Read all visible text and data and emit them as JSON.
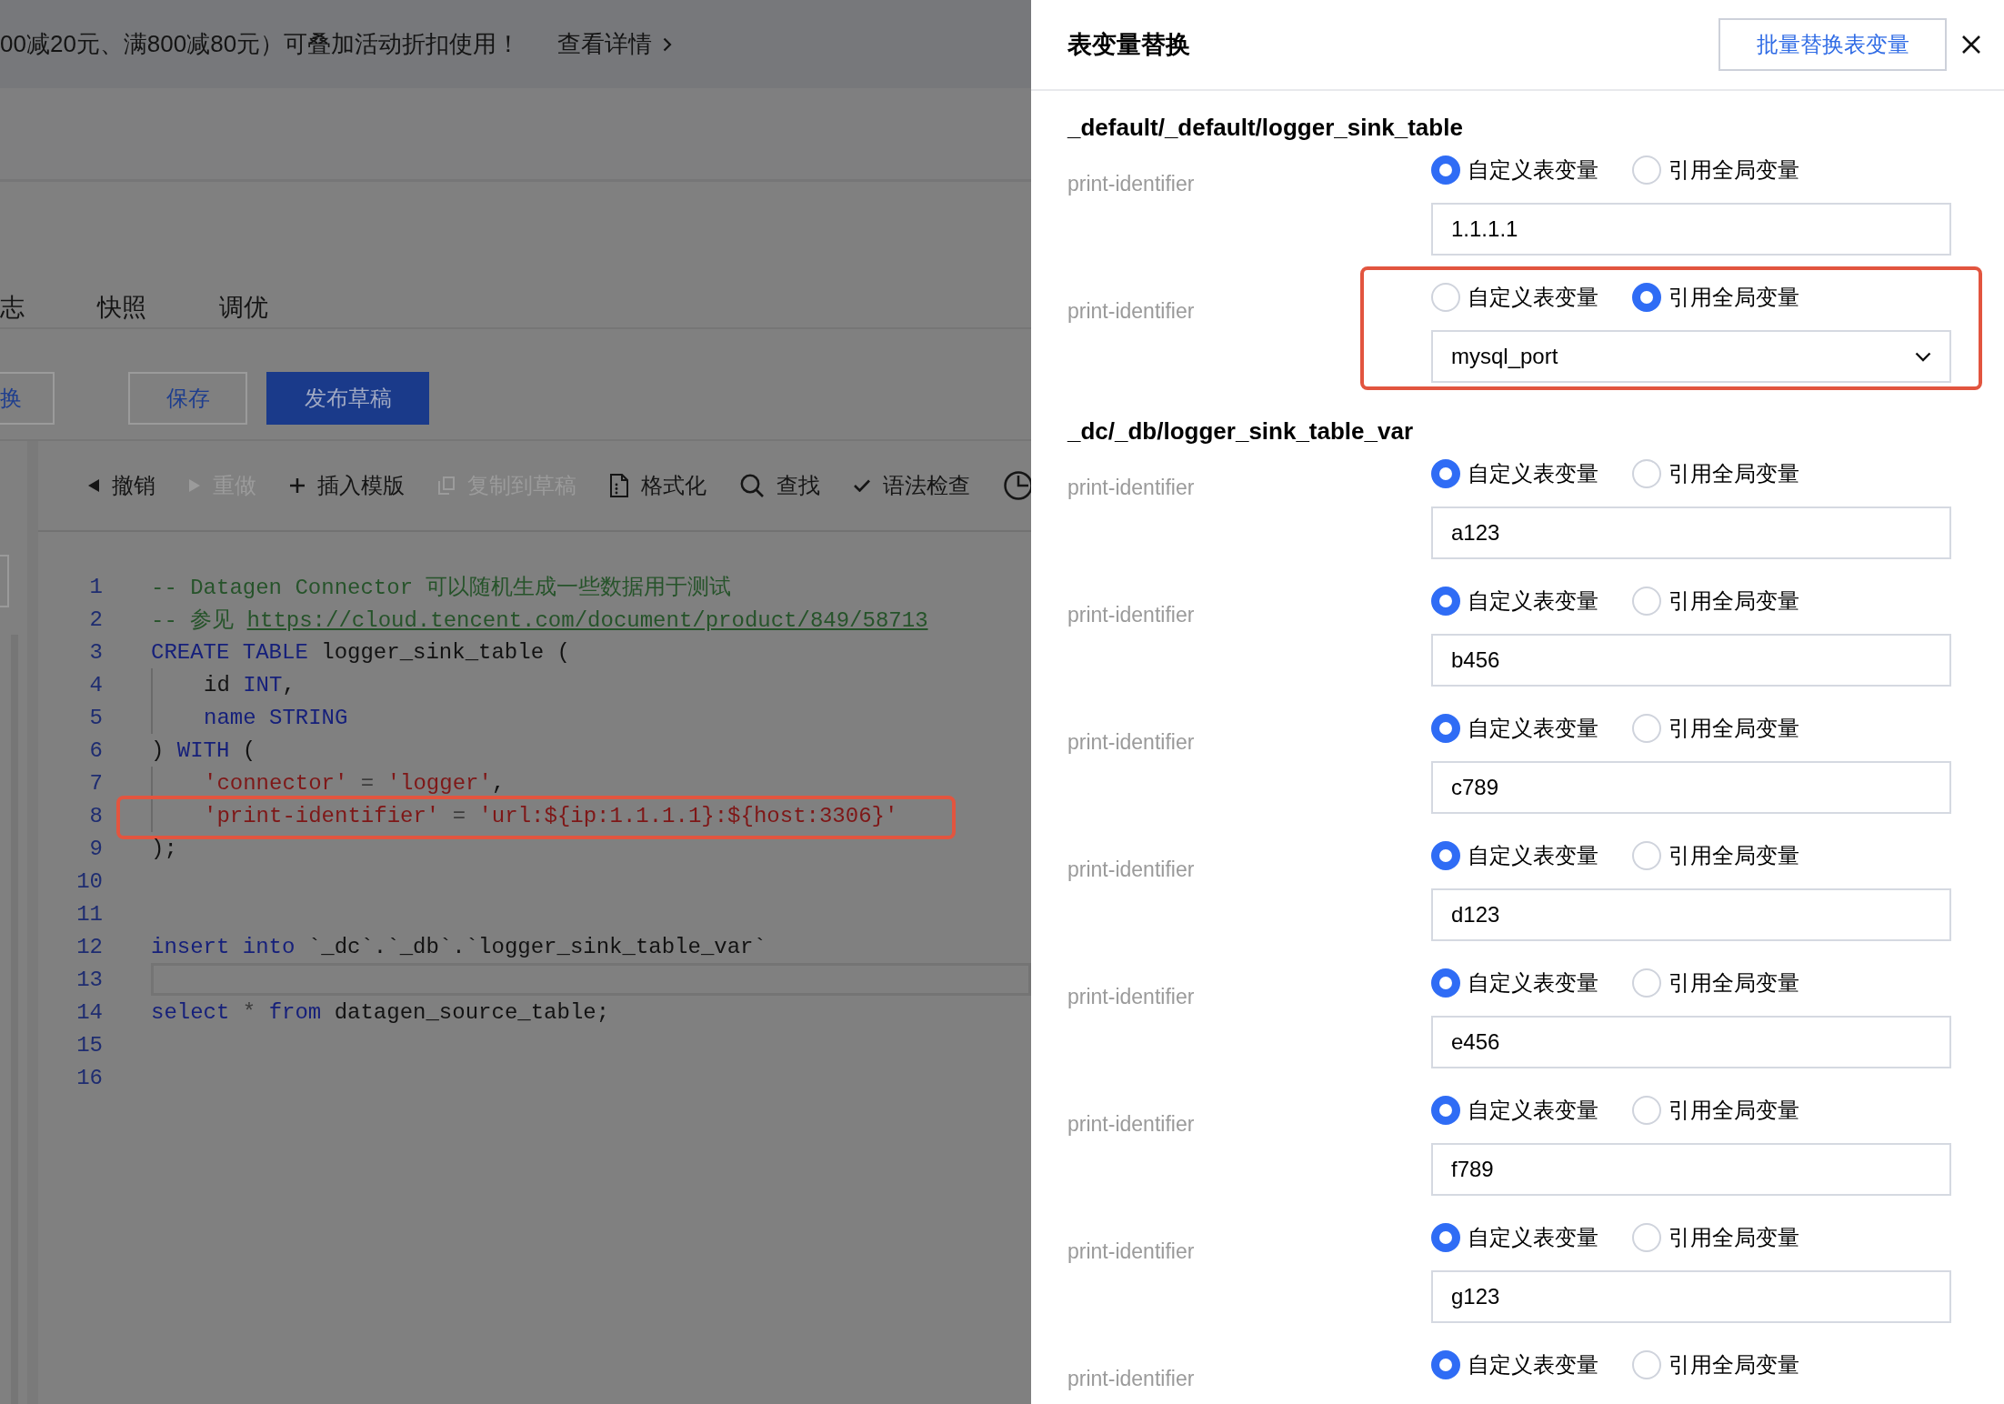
{
  "banner": {
    "text": "00减20元、满800减80元）可叠加活动折扣使用！",
    "link": "查看详情"
  },
  "tabs": [
    {
      "label": "志",
      "selected": false
    },
    {
      "label": "快照",
      "selected": false
    },
    {
      "label": "调优",
      "selected": false
    }
  ],
  "actions": [
    {
      "label": "换",
      "kind": "outline"
    },
    {
      "label": "保存",
      "kind": "outline"
    },
    {
      "label": "发布草稿",
      "kind": "primary"
    }
  ],
  "editor": {
    "toolbar": [
      {
        "label": "撤销",
        "disabled": false
      },
      {
        "label": "重做",
        "disabled": true
      },
      {
        "label": "插入模版",
        "disabled": false
      },
      {
        "label": "复制到草稿",
        "disabled": true
      },
      {
        "label": "格式化",
        "disabled": false
      },
      {
        "label": "查找",
        "disabled": false
      },
      {
        "label": "语法检查",
        "disabled": false
      }
    ],
    "lines": [
      {
        "number": "1",
        "tokens": [
          {
            "kind": "comment",
            "text": "-- Datagen Connector 可以随机生成一些数据用于测试"
          }
        ],
        "indented": false,
        "current": false,
        "boxed": false
      },
      {
        "number": "2",
        "tokens": [
          {
            "kind": "comment",
            "text": "-- 参见 "
          },
          {
            "kind": "link",
            "text": "https://cloud.tencent.com/document/product/849/58713"
          }
        ],
        "indented": false,
        "current": false,
        "boxed": false
      },
      {
        "number": "3",
        "tokens": [
          {
            "kind": "keyword",
            "text": "CREATE TABLE"
          },
          {
            "kind": "text",
            "text": " logger_sink_table ("
          }
        ],
        "indented": false,
        "current": false,
        "boxed": false
      },
      {
        "number": "4",
        "tokens": [
          {
            "kind": "text",
            "text": "id "
          },
          {
            "kind": "keyword",
            "text": "INT"
          },
          {
            "kind": "text",
            "text": ","
          }
        ],
        "indented": true,
        "current": false,
        "boxed": false
      },
      {
        "number": "5",
        "tokens": [
          {
            "kind": "keyword",
            "text": "name STRING"
          }
        ],
        "indented": true,
        "current": false,
        "boxed": false
      },
      {
        "number": "6",
        "tokens": [
          {
            "kind": "text",
            "text": ") "
          },
          {
            "kind": "keyword",
            "text": "WITH"
          },
          {
            "kind": "text",
            "text": " ("
          }
        ],
        "indented": false,
        "current": false,
        "boxed": false
      },
      {
        "number": "7",
        "tokens": [
          {
            "kind": "string",
            "text": "'connector'"
          },
          {
            "kind": "operator",
            "text": " = "
          },
          {
            "kind": "string",
            "text": "'logger'"
          },
          {
            "kind": "text",
            "text": ","
          }
        ],
        "indented": true,
        "current": false,
        "boxed": false
      },
      {
        "number": "8",
        "tokens": [
          {
            "kind": "string",
            "text": "'print-identifier'"
          },
          {
            "kind": "operator",
            "text": " = "
          },
          {
            "kind": "string",
            "text": "'url:${ip:1.1.1.1}:${host:3306}'"
          }
        ],
        "indented": true,
        "current": false,
        "boxed": true
      },
      {
        "number": "9",
        "tokens": [
          {
            "kind": "text",
            "text": ");"
          }
        ],
        "indented": false,
        "current": false,
        "boxed": false
      },
      {
        "number": "10",
        "indented": false,
        "current": false,
        "boxed": false
      },
      {
        "number": "11",
        "indented": false,
        "current": false,
        "boxed": false
      },
      {
        "number": "12",
        "tokens": [
          {
            "kind": "keyword",
            "text": "insert into"
          },
          {
            "kind": "text",
            "text": " `_dc`.`_db`.`logger_sink_table_var`"
          }
        ],
        "indented": false,
        "current": false,
        "boxed": false
      },
      {
        "number": "13",
        "indented": false,
        "current": true,
        "boxed": false
      },
      {
        "number": "14",
        "tokens": [
          {
            "kind": "keyword",
            "text": "select"
          },
          {
            "kind": "operator",
            "text": " * "
          },
          {
            "kind": "keyword",
            "text": "from"
          },
          {
            "kind": "text",
            "text": " datagen_source_table;"
          }
        ],
        "indented": false,
        "current": false,
        "boxed": false
      },
      {
        "number": "15",
        "indented": false,
        "current": false,
        "boxed": false
      },
      {
        "number": "16",
        "indented": false,
        "current": false,
        "boxed": false
      }
    ]
  },
  "drawer": {
    "title": "表变量替换",
    "batch_button": "批量替换表变量",
    "sections": [
      {
        "title": "_default/_default/logger_sink_table",
        "rows": [
          {
            "label": "print-identifier",
            "options": [
              {
                "label": "自定义表变量",
                "selected": true
              },
              {
                "label": "引用全局变量",
                "selected": false
              }
            ],
            "field": {
              "kind": "input",
              "value": "1.1.1.1"
            },
            "boxed": false
          },
          {
            "label": "print-identifier",
            "options": [
              {
                "label": "自定义表变量",
                "selected": false
              },
              {
                "label": "引用全局变量",
                "selected": true
              }
            ],
            "field": {
              "kind": "select",
              "value": "mysql_port"
            },
            "boxed": true
          }
        ]
      },
      {
        "title": "_dc/_db/logger_sink_table_var",
        "rows": [
          {
            "label": "print-identifier",
            "options": [
              {
                "label": "自定义表变量",
                "selected": true
              },
              {
                "label": "引用全局变量",
                "selected": false
              }
            ],
            "field": {
              "kind": "input",
              "value": "a123"
            },
            "boxed": false
          },
          {
            "label": "print-identifier",
            "options": [
              {
                "label": "自定义表变量",
                "selected": true
              },
              {
                "label": "引用全局变量",
                "selected": false
              }
            ],
            "field": {
              "kind": "input",
              "value": "b456"
            },
            "boxed": false
          },
          {
            "label": "print-identifier",
            "options": [
              {
                "label": "自定义表变量",
                "selected": true
              },
              {
                "label": "引用全局变量",
                "selected": false
              }
            ],
            "field": {
              "kind": "input",
              "value": "c789"
            },
            "boxed": false
          },
          {
            "label": "print-identifier",
            "options": [
              {
                "label": "自定义表变量",
                "selected": true
              },
              {
                "label": "引用全局变量",
                "selected": false
              }
            ],
            "field": {
              "kind": "input",
              "value": "d123"
            },
            "boxed": false
          },
          {
            "label": "print-identifier",
            "options": [
              {
                "label": "自定义表变量",
                "selected": true
              },
              {
                "label": "引用全局变量",
                "selected": false
              }
            ],
            "field": {
              "kind": "input",
              "value": "e456"
            },
            "boxed": false
          },
          {
            "label": "print-identifier",
            "options": [
              {
                "label": "自定义表变量",
                "selected": true
              },
              {
                "label": "引用全局变量",
                "selected": false
              }
            ],
            "field": {
              "kind": "input",
              "value": "f789"
            },
            "boxed": false
          },
          {
            "label": "print-identifier",
            "options": [
              {
                "label": "自定义表变量",
                "selected": true
              },
              {
                "label": "引用全局变量",
                "selected": false
              }
            ],
            "field": {
              "kind": "input",
              "value": "g123"
            },
            "boxed": false
          },
          {
            "label": "print-identifier",
            "options": [
              {
                "label": "自定义表变量",
                "selected": true
              },
              {
                "label": "引用全局变量",
                "selected": false
              }
            ],
            "boxed": false
          }
        ]
      }
    ]
  }
}
